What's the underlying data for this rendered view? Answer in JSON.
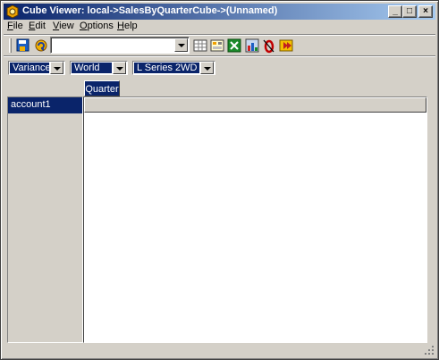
{
  "window": {
    "title": "Cube Viewer: local->SalesByQuarterCube->(Unnamed)",
    "controls": {
      "minimize": "_",
      "maximize": "□",
      "close": "×"
    }
  },
  "menu": [
    {
      "label": "File",
      "mnemonic": "F",
      "rest": "ile"
    },
    {
      "label": "Edit",
      "mnemonic": "E",
      "rest": "dit"
    },
    {
      "label": "View",
      "mnemonic": "V",
      "rest": "iew"
    },
    {
      "label": "Options",
      "mnemonic": "O",
      "rest": "ptions"
    },
    {
      "label": "Help",
      "mnemonic": "H",
      "rest": "elp"
    }
  ],
  "toolbar": {
    "view_combo_value": "",
    "icons": [
      "save-view-icon",
      "recalculate-icon",
      "slice-to-spreadsheet-icon",
      "snapshot-icon",
      "export-excel-icon",
      "chart-icon",
      "zero-suppression-icon",
      "forward-icon"
    ]
  },
  "dimensions": [
    {
      "name": "title-dim-1",
      "value": "Variance"
    },
    {
      "name": "title-dim-2",
      "value": "World"
    },
    {
      "name": "title-dim-3",
      "value": "L Series 2WD"
    }
  ],
  "grid": {
    "column_dimension": "Quarter",
    "row_dimension": "account1"
  },
  "colors": {
    "selection": "#0a246a",
    "face": "#d4d0c8"
  }
}
